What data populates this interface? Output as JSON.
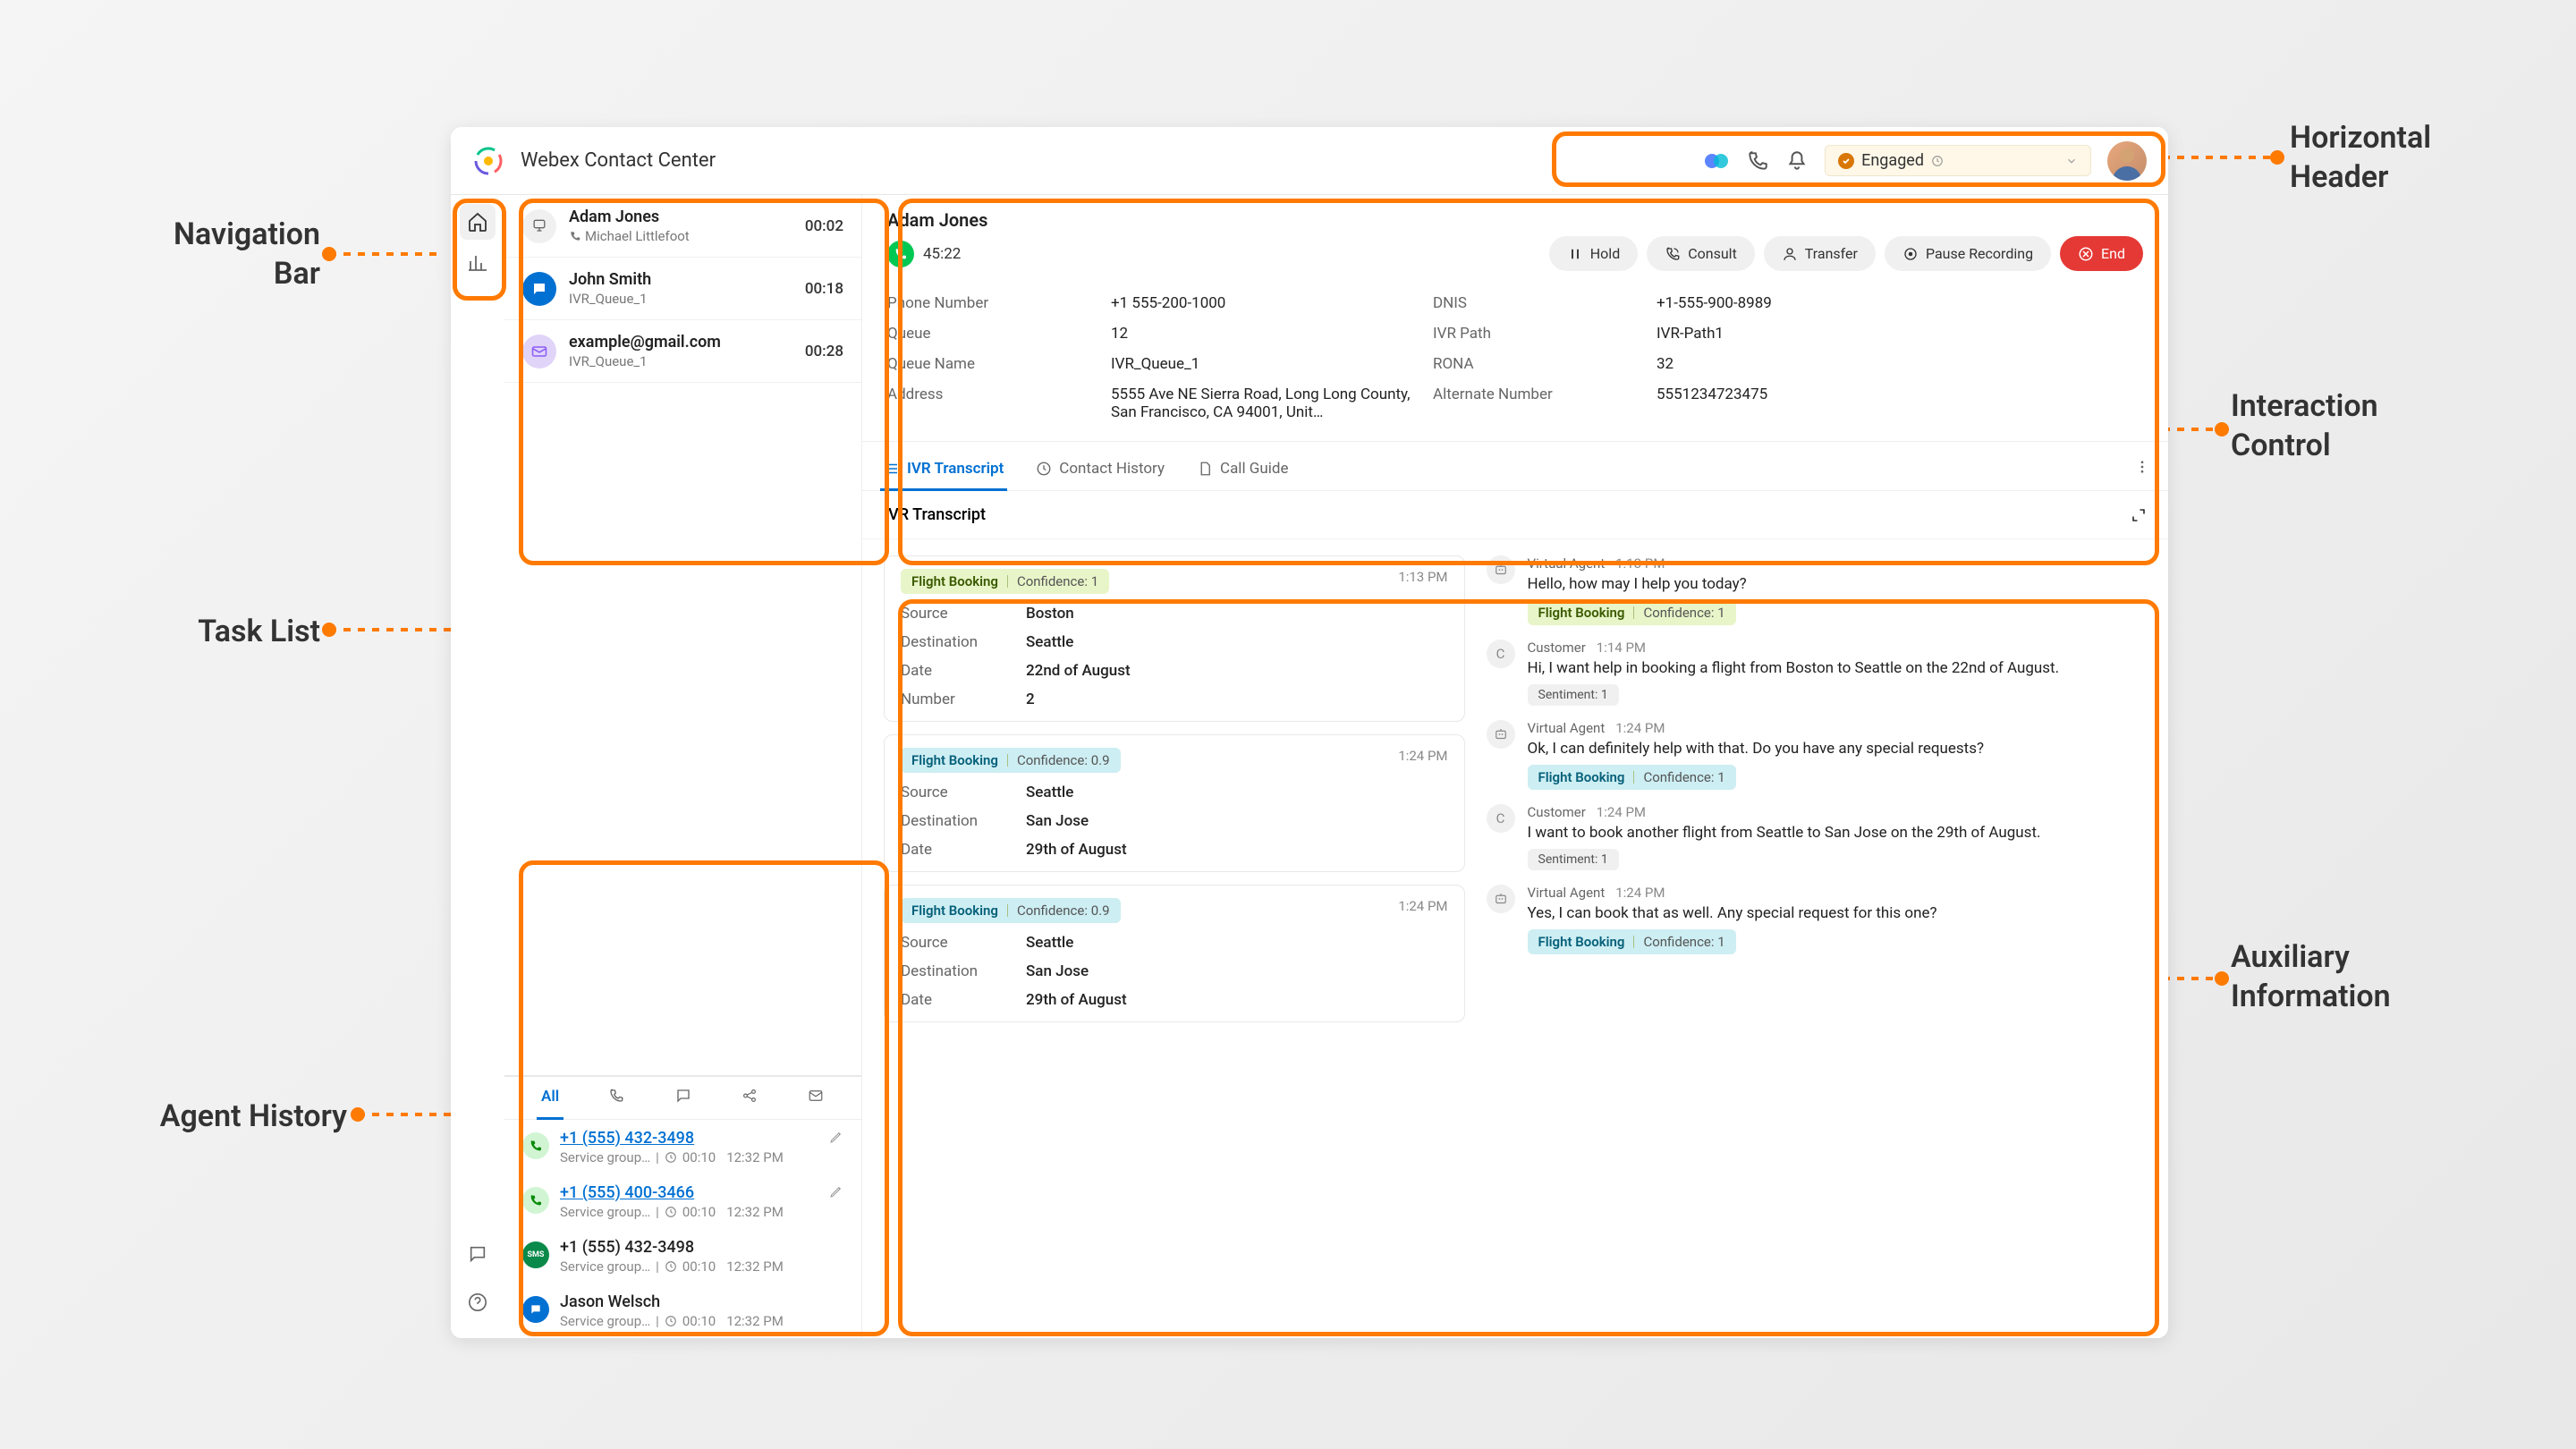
{
  "annotations": {
    "navbar": "Navigation\nBar",
    "tasklist": "Task List",
    "agenthistory": "Agent History",
    "header": "Horizontal\nHeader",
    "interaction": "Interaction\nControl",
    "aux": "Auxiliary\nInformation"
  },
  "header": {
    "title": "Webex Contact Center",
    "status": "Engaged"
  },
  "tasks": [
    {
      "name": "Adam Jones",
      "sub": "Michael Littlefoot",
      "timer": "00:02",
      "type": "call"
    },
    {
      "name": "John Smith",
      "sub": "IVR_Queue_1",
      "timer": "00:18",
      "type": "chat"
    },
    {
      "name": "example@gmail.com",
      "sub": "IVR_Queue_1",
      "timer": "00:28",
      "type": "email"
    }
  ],
  "history_tab_all": "All",
  "history": [
    {
      "title": "+1 (555) 432-3498",
      "group": "Service group…",
      "dur": "00:10",
      "time": "12:32 PM",
      "icon": "call",
      "link": true,
      "edit": true
    },
    {
      "title": "+1 (555) 400-3466",
      "group": "Service group…",
      "dur": "00:10",
      "time": "12:32 PM",
      "icon": "call",
      "link": true,
      "edit": true
    },
    {
      "title": "+1 (555) 432-3498",
      "group": "Service group…",
      "dur": "00:10",
      "time": "12:32 PM",
      "icon": "sms",
      "link": false,
      "edit": false
    },
    {
      "title": "Jason Welsch",
      "group": "Service group…",
      "dur": "00:10",
      "time": "12:32 PM",
      "icon": "chat",
      "link": false,
      "edit": false
    }
  ],
  "interaction": {
    "name": "Adam Jones",
    "timer": "45:22",
    "buttons": {
      "hold": "Hold",
      "consult": "Consult",
      "transfer": "Transfer",
      "pause": "Pause Recording",
      "end": "End"
    },
    "cad": {
      "phone_l": "Phone Number",
      "phone_v": "+1 555-200-1000",
      "queue_l": "Queue",
      "queue_v": "12",
      "queuen_l": "Queue Name",
      "queuen_v": "IVR_Queue_1",
      "addr_l": "Address",
      "addr_v": "5555 Ave NE Sierra Road, Long Long County, San Francisco, CA 94001, Unit…",
      "dnis_l": "DNIS",
      "dnis_v": "+1-555-900-8989",
      "ivr_l": "IVR Path",
      "ivr_v": "IVR-Path1",
      "rona_l": "RONA",
      "rona_v": "32",
      "alt_l": "Alternate Number",
      "alt_v": "5551234723475"
    }
  },
  "aux": {
    "tabs": {
      "ivr": "IVR Transcript",
      "contact": "Contact History",
      "guide": "Call Guide"
    },
    "panel_title": "IVR Transcript",
    "labels": {
      "source": "Source",
      "dest": "Destination",
      "date": "Date",
      "number": "Number",
      "conf_prefix": "Confidence: ",
      "senti_prefix": "Sentiment: "
    },
    "cards": [
      {
        "time": "1:13 PM",
        "intent": "Flight Booking",
        "conf": "1",
        "pill": "green",
        "rows": [
          [
            "Source",
            "Boston"
          ],
          [
            "Destination",
            "Seattle"
          ],
          [
            "Date",
            "22nd of August"
          ],
          [
            "Number",
            "2"
          ]
        ]
      },
      {
        "time": "1:24 PM",
        "intent": "Flight Booking",
        "conf": "0.9",
        "pill": "blue",
        "rows": [
          [
            "Source",
            "Seattle"
          ],
          [
            "Destination",
            "San Jose"
          ],
          [
            "Date",
            "29th of August"
          ]
        ]
      },
      {
        "time": "1:24 PM",
        "intent": "Flight Booking",
        "conf": "0.9",
        "pill": "blue",
        "rows": [
          [
            "Source",
            "Seattle"
          ],
          [
            "Destination",
            "San Jose"
          ],
          [
            "Date",
            "29th of August"
          ]
        ]
      }
    ],
    "conv": [
      {
        "role": "Virtual Agent",
        "time": "1:13 PM",
        "avatar": "bot",
        "text": "Hello, how may I help you today?",
        "tag": {
          "type": "intent",
          "name": "Flight Booking",
          "conf": "1",
          "pill": "green"
        }
      },
      {
        "role": "Customer",
        "time": "1:14 PM",
        "avatar": "C",
        "text": "Hi, I want help in booking a flight from Boston to Seattle on the 22nd of August.",
        "tag": {
          "type": "sentiment",
          "value": "1"
        }
      },
      {
        "role": "Virtual Agent",
        "time": "1:24 PM",
        "avatar": "bot",
        "text": "Ok, I can definitely help with that. Do you have any special requests?",
        "tag": {
          "type": "intent",
          "name": "Flight Booking",
          "conf": "1",
          "pill": "blue"
        }
      },
      {
        "role": "Customer",
        "time": "1:24 PM",
        "avatar": "C",
        "text": "I want to book another flight from Seattle to San Jose on the 29th of August.",
        "tag": {
          "type": "sentiment",
          "value": "1"
        }
      },
      {
        "role": "Virtual Agent",
        "time": "1:24 PM",
        "avatar": "bot",
        "text": "Yes, I can book that as well. Any special request for this one?",
        "tag": {
          "type": "intent",
          "name": "Flight Booking",
          "conf": "1",
          "pill": "blue"
        }
      }
    ]
  }
}
